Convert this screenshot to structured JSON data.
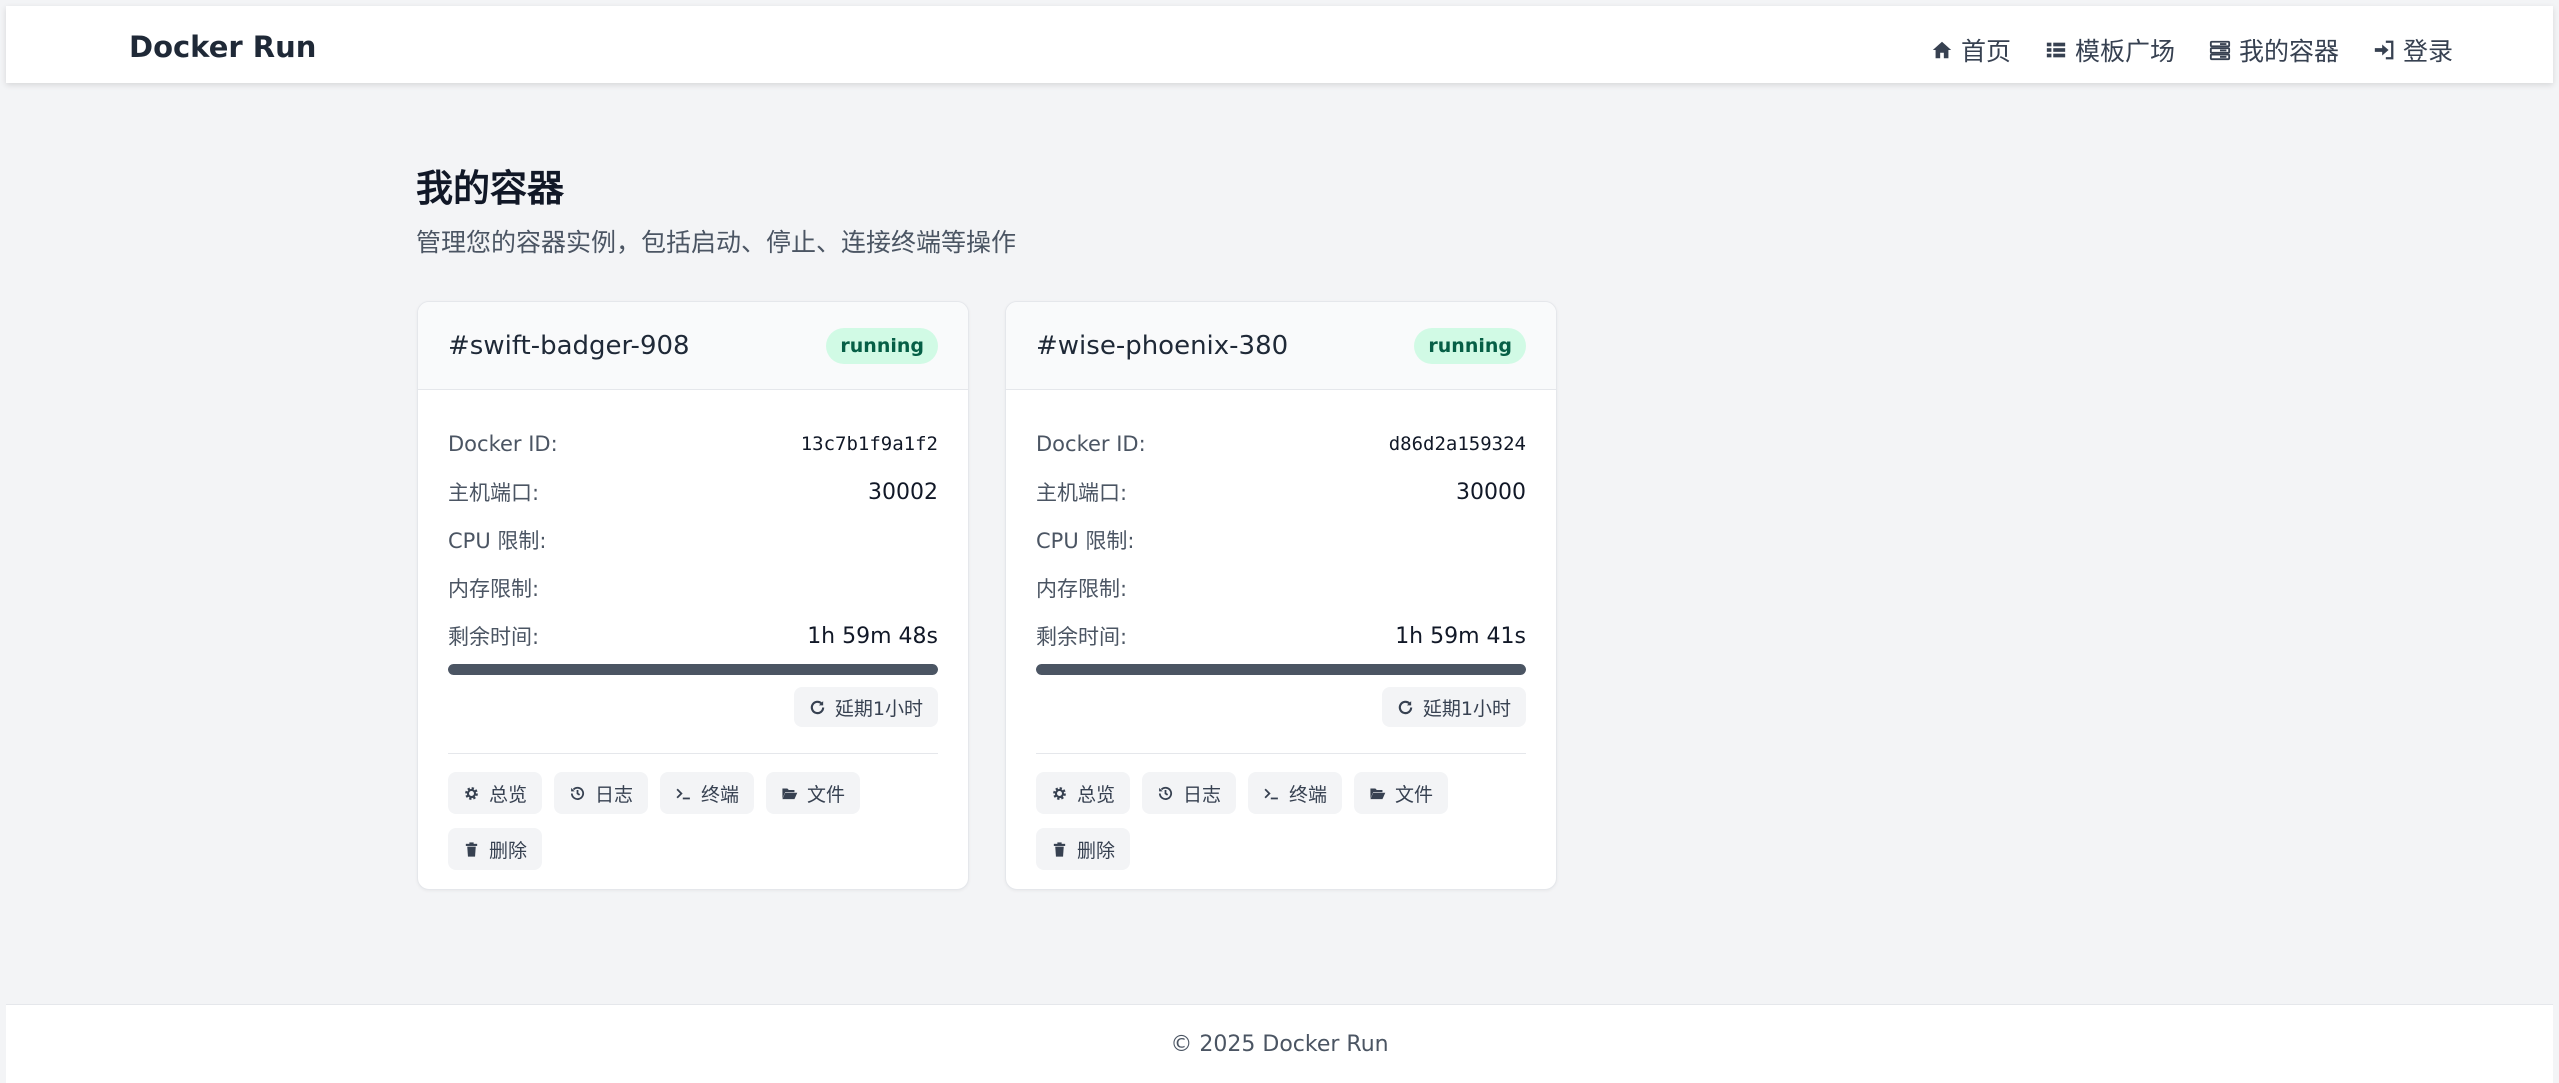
{
  "header": {
    "brand": "Docker Run",
    "nav": [
      {
        "label": "首页",
        "icon": "home-icon"
      },
      {
        "label": "模板广场",
        "icon": "list-icon"
      },
      {
        "label": "我的容器",
        "icon": "server-icon"
      },
      {
        "label": "登录",
        "icon": "sign-in-icon"
      }
    ]
  },
  "main": {
    "title": "我的容器",
    "subtitle": "管理您的容器实例，包括启动、停止、连接终端等操作",
    "labels": {
      "docker_id": "Docker ID:",
      "host_port": "主机端口:",
      "cpu_limit": "CPU 限制:",
      "mem_limit": "内存限制:",
      "remaining": "剩余时间:"
    },
    "buttons": {
      "extend": "延期1小时",
      "overview": "总览",
      "logs": "日志",
      "terminal": "终端",
      "files": "文件",
      "delete": "删除"
    },
    "containers": [
      {
        "name": "#swift-badger-908",
        "status": "running",
        "docker_id": "13c7b1f9a1f2",
        "host_port": "30002",
        "cpu_limit": "",
        "mem_limit": "",
        "remaining": "1h 59m 48s",
        "progress": 1.0
      },
      {
        "name": "#wise-phoenix-380",
        "status": "running",
        "docker_id": "d86d2a159324",
        "host_port": "30000",
        "cpu_limit": "",
        "mem_limit": "",
        "remaining": "1h 59m 41s",
        "progress": 1.0
      }
    ]
  },
  "footer": {
    "text": "© 2025 Docker Run"
  },
  "colors": {
    "background": "#f3f4f6",
    "badge_bg": "#d1fae5",
    "badge_text": "#065f46",
    "progress_fill": "#4b5563"
  }
}
